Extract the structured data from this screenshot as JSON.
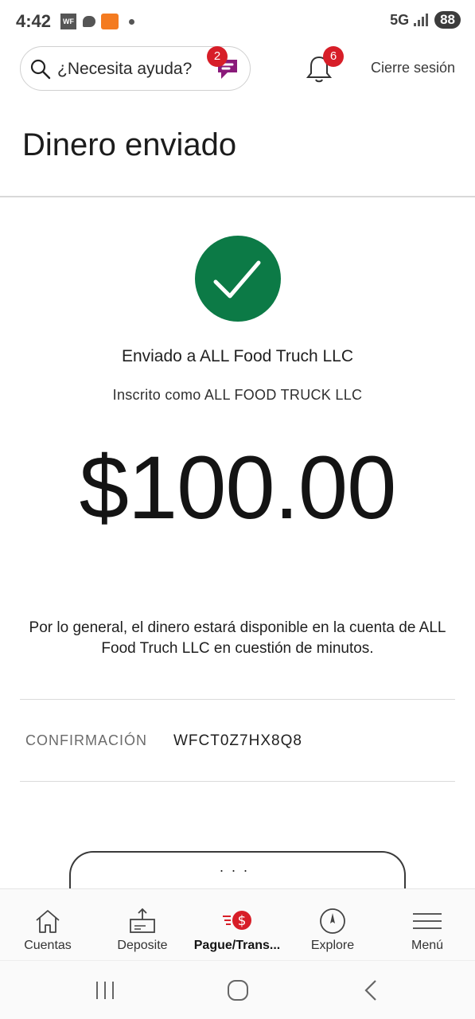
{
  "status_bar": {
    "time": "4:42",
    "app_wf": "WF",
    "network": "5G",
    "battery": "88"
  },
  "header": {
    "search_label": "¿Necesita ayuda?",
    "assistant_badge": "2",
    "notifications_badge": "6",
    "logout_label": "Cierre sesión"
  },
  "page": {
    "title": "Dinero enviado"
  },
  "confirmation": {
    "sent_to": "Enviado a ALL Food Truch LLC",
    "enrolled_as": "Inscrito como ALL FOOD TRUCK LLC",
    "amount": "$100.00",
    "availability_note": "Por lo general, el dinero estará disponible en la cuenta de ALL Food Truch LLC en cuestión de minutos.",
    "confirmation_label": "CONFIRMACIÓN",
    "confirmation_code": "WFCT0Z7HX8Q8",
    "more_button": "..."
  },
  "tabbar": {
    "tabs": [
      {
        "label": "Cuentas",
        "icon": "home-icon"
      },
      {
        "label": "Deposite",
        "icon": "deposit-icon"
      },
      {
        "label": "Pague/Trans...",
        "icon": "pay-transfer-icon"
      },
      {
        "label": "Explore",
        "icon": "compass-icon"
      },
      {
        "label": "Menú",
        "icon": "menu-icon"
      }
    ]
  },
  "colors": {
    "success_green": "#0c7a46",
    "badge_red": "#d71e28",
    "assistant_purple": "#8a1a7a"
  }
}
